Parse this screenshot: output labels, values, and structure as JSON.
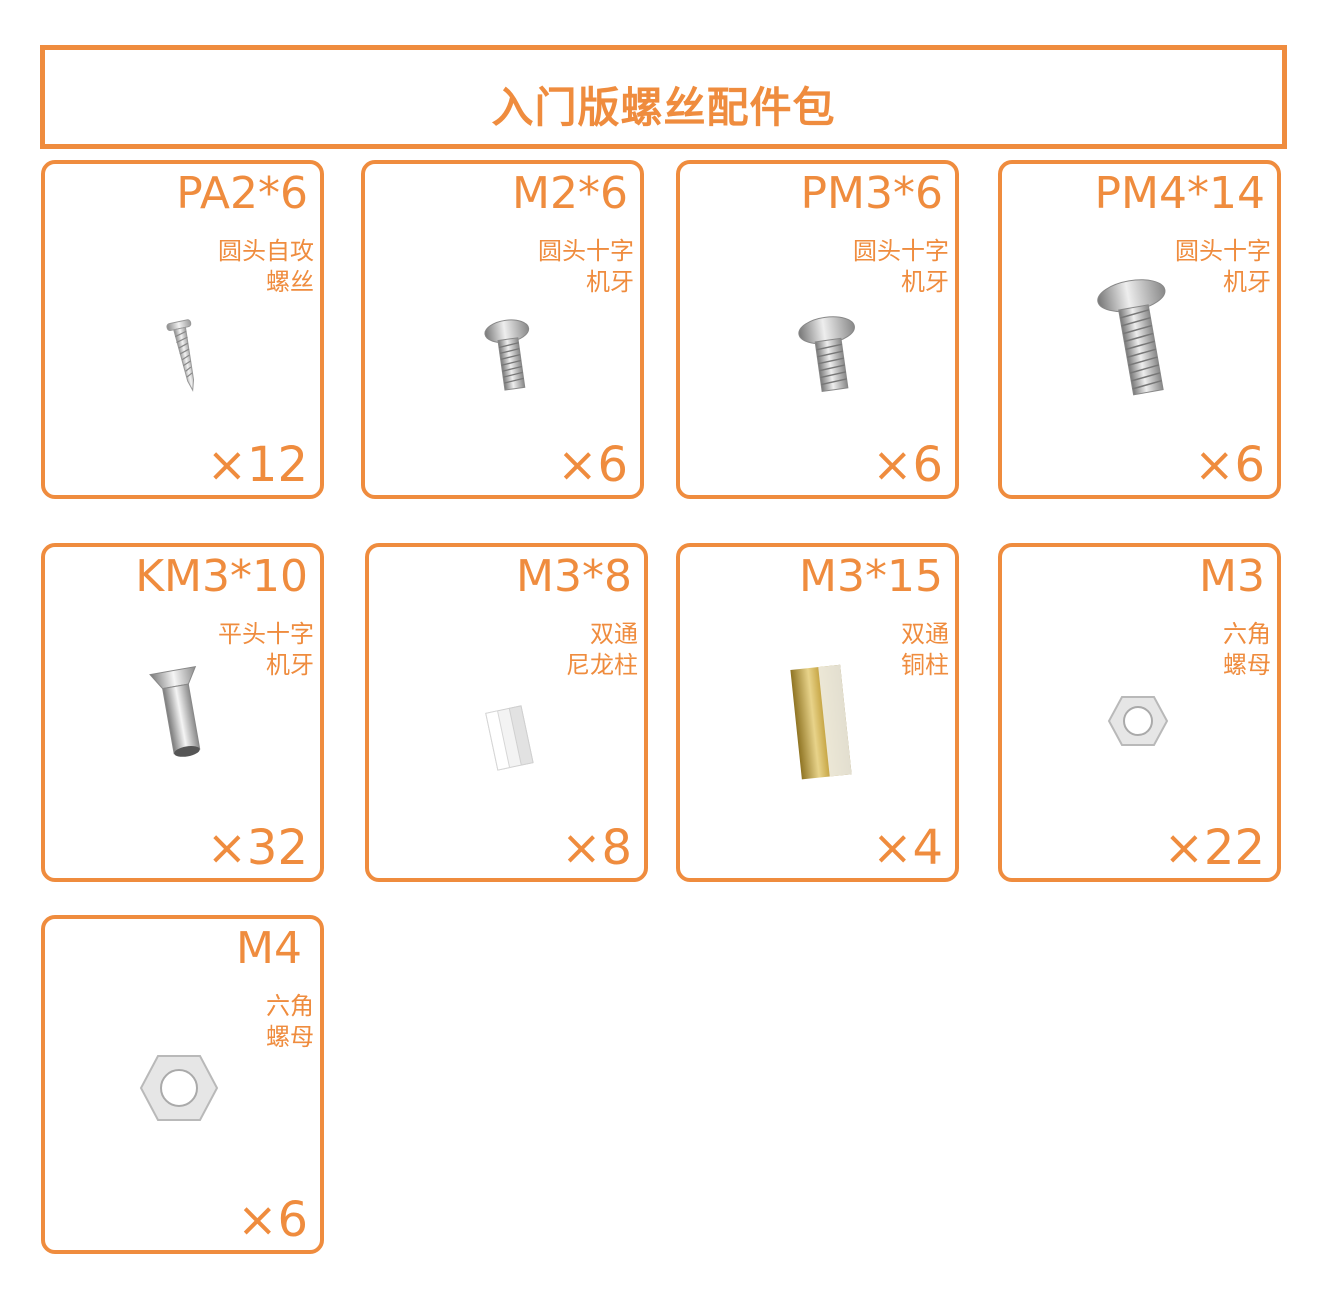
{
  "title": "入门版螺丝配件包",
  "colors": {
    "accent": "#ef8c3e",
    "steel": "#b5b5b5",
    "brass": "#c9a94a",
    "nylon": "#eeeeee"
  },
  "items": [
    {
      "code": "PA2*6",
      "desc": [
        "圆头自攻",
        "螺丝"
      ],
      "qty": "×12",
      "icon": "self-tapping-screw-icon"
    },
    {
      "code": "M2*6",
      "desc": [
        "圆头十字",
        "机牙"
      ],
      "qty": "×6",
      "icon": "pan-head-machine-screw-icon"
    },
    {
      "code": "PM3*6",
      "desc": [
        "圆头十字",
        "机牙"
      ],
      "qty": "×6",
      "icon": "pan-head-machine-screw-icon"
    },
    {
      "code": "PM4*14",
      "desc": [
        "圆头十字",
        "机牙"
      ],
      "qty": "×6",
      "icon": "pan-head-machine-screw-icon"
    },
    {
      "code": "KM3*10",
      "desc": [
        "平头十字",
        "机牙"
      ],
      "qty": "×32",
      "icon": "countersunk-screw-icon"
    },
    {
      "code": "M3*8",
      "desc": [
        "双通",
        "尼龙柱"
      ],
      "qty": "×8",
      "icon": "nylon-standoff-icon"
    },
    {
      "code": "M3*15",
      "desc": [
        "双通",
        "铜柱"
      ],
      "qty": "×4",
      "icon": "brass-standoff-icon"
    },
    {
      "code": "M3",
      "desc": [
        "六角",
        "螺母"
      ],
      "qty": "×22",
      "icon": "hex-nut-icon"
    },
    {
      "code": "M4",
      "desc": [
        "六角",
        "螺母"
      ],
      "qty": "×6",
      "icon": "hex-nut-icon"
    }
  ]
}
